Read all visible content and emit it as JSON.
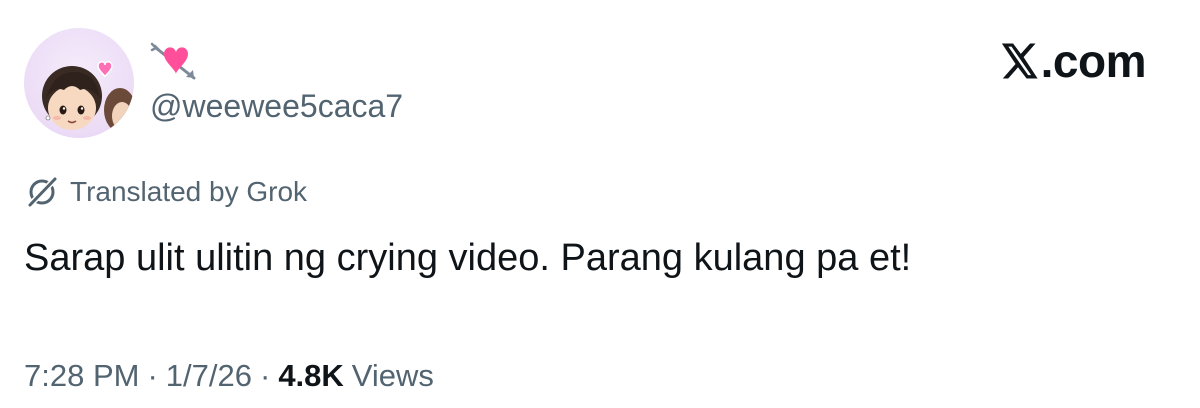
{
  "user": {
    "display_name_emoji": "💘",
    "handle": "@weewee5caca7",
    "avatar_icon": "chibi-boy-avatar-icon"
  },
  "brand": {
    "label": ".com",
    "icon": "x-logo-icon"
  },
  "translation": {
    "label": "Translated by Grok",
    "icon": "grok-icon"
  },
  "tweet": {
    "text": "Sarap ulit ulitin ng crying video. Parang kulang pa et!"
  },
  "meta": {
    "time": "7:28 PM",
    "separator": "·",
    "date": "1/7/26",
    "views_count": "4.8K",
    "views_label": "Views"
  },
  "colors": {
    "primary_text": "#0f1419",
    "secondary_text": "#536471",
    "background": "#ffffff",
    "avatar_bg": "#ecdcf6",
    "heart_pink": "#ff6fb5"
  }
}
